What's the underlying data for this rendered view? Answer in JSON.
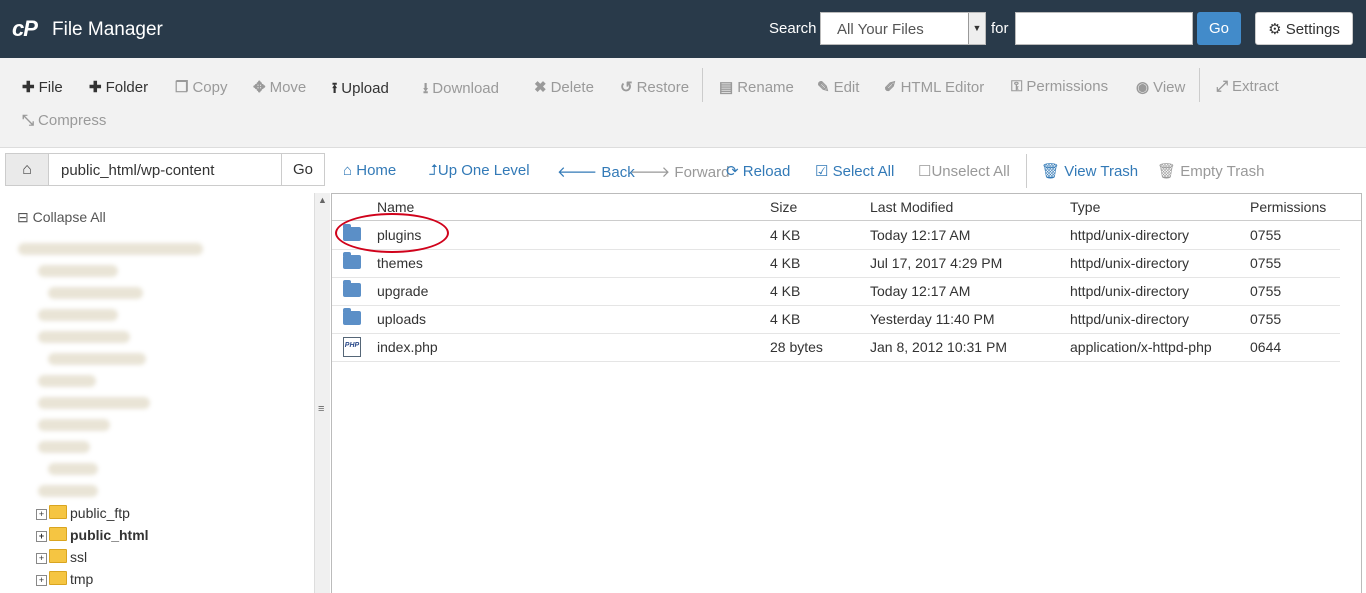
{
  "header": {
    "logo": "cP",
    "title": "File Manager",
    "search_label": "Search",
    "search_scope": "All Your Files",
    "for_label": "for",
    "search_value": "",
    "go_label": "Go",
    "settings_label": "Settings"
  },
  "toolbar": {
    "file": "File",
    "folder": "Folder",
    "copy": "Copy",
    "move": "Move",
    "upload": "Upload",
    "download": "Download",
    "delete": "Delete",
    "restore": "Restore",
    "rename": "Rename",
    "edit": "Edit",
    "html_editor": "HTML Editor",
    "permissions": "Permissions",
    "view": "View",
    "extract": "Extract",
    "compress": "Compress"
  },
  "path": {
    "value": "public_html/wp-content",
    "go_label": "Go"
  },
  "nav": {
    "home": "Home",
    "up_one_level": "Up One Level",
    "back": "Back",
    "forward": "Forward",
    "reload": "Reload",
    "select_all": "Select All",
    "unselect_all": "Unselect All",
    "view_trash": "View Trash",
    "empty_trash": "Empty Trash"
  },
  "tree": {
    "collapse_all": "Collapse All",
    "items": [
      {
        "label": "public_ftp"
      },
      {
        "label": "public_html"
      },
      {
        "label": "ssl"
      },
      {
        "label": "tmp"
      }
    ]
  },
  "list": {
    "columns": {
      "name": "Name",
      "size": "Size",
      "modified": "Last Modified",
      "type": "Type",
      "permissions": "Permissions"
    },
    "rows": [
      {
        "name": "plugins",
        "size": "4 KB",
        "modified": "Today 12:17 AM",
        "type": "httpd/unix-directory",
        "perms": "0755",
        "icon": "folder-icon"
      },
      {
        "name": "themes",
        "size": "4 KB",
        "modified": "Jul 17, 2017 4:29 PM",
        "type": "httpd/unix-directory",
        "perms": "0755",
        "icon": "folder-icon"
      },
      {
        "name": "upgrade",
        "size": "4 KB",
        "modified": "Today 12:17 AM",
        "type": "httpd/unix-directory",
        "perms": "0755",
        "icon": "folder-icon"
      },
      {
        "name": "uploads",
        "size": "4 KB",
        "modified": "Yesterday 11:40 PM",
        "type": "httpd/unix-directory",
        "perms": "0755",
        "icon": "folder-icon"
      },
      {
        "name": "index.php",
        "size": "28 bytes",
        "modified": "Jan 8, 2012 10:31 PM",
        "type": "application/x-httpd-php",
        "perms": "0644",
        "icon": "php-file-icon"
      }
    ]
  },
  "colors": {
    "header_bg": "#293a4a",
    "accent": "#428bca",
    "link": "#337ab7",
    "highlight_circle": "#d0021b"
  }
}
